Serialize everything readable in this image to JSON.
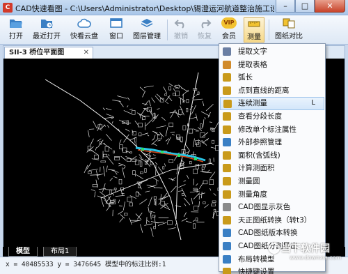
{
  "window": {
    "title": "CAD快速看图 - C:\\Users\\Administrator\\Desktop\\锡澄运河航道整治施工设计图纸\\锡澄运...",
    "app_icon_glyph": "C",
    "minimize": "–",
    "maximize": "□",
    "close": "✕"
  },
  "toolbar": {
    "open": "打开",
    "recent": "最近打开",
    "cloud": "快看云盘",
    "window": "窗口",
    "layers": "图层管理",
    "undo": "撤销",
    "redo": "恢复",
    "vip": "会员",
    "vip_badge": "VIP",
    "measure": "测量",
    "compare": "图纸对比"
  },
  "document": {
    "tab_title": "SII-3 桥位平面图",
    "tab_close": "✕"
  },
  "layouts": {
    "model": "模型",
    "layout1": "布局1"
  },
  "status": {
    "text": "x = 40485533  y = 3476645  模型中的标注比例:1"
  },
  "measure_menu": {
    "items": [
      {
        "label": "提取文字",
        "icon": "extract-text-icon",
        "color": "#6b7fa3"
      },
      {
        "label": "提取表格",
        "icon": "extract-table-icon",
        "color": "#d18a2a"
      },
      {
        "label": "弧长",
        "icon": "arc-length-icon",
        "color": "#c99a1a"
      },
      {
        "label": "点到直线的距离",
        "icon": "point-line-distance-icon",
        "color": "#c99a1a"
      },
      {
        "label": "连续测量",
        "icon": "continuous-measure-icon",
        "color": "#c99a1a",
        "shortcut": "L",
        "highlighted": true
      },
      {
        "label": "查看分段长度",
        "icon": "segment-length-icon",
        "color": "#c99a1a"
      },
      {
        "label": "修改单个标注属性",
        "icon": "edit-dimension-icon",
        "color": "#c99a1a"
      },
      {
        "label": "外部参照管理",
        "icon": "xref-manager-icon",
        "color": "#3a7fc4"
      },
      {
        "label": "面积(含弧线)",
        "icon": "area-arc-icon",
        "color": "#c99a1a"
      },
      {
        "label": "计算测面积",
        "icon": "calc-area-icon",
        "color": "#c99a1a"
      },
      {
        "label": "测量圆",
        "icon": "measure-circle-icon",
        "color": "#c99a1a"
      },
      {
        "label": "测量角度",
        "icon": "measure-angle-icon",
        "color": "#c99a1a"
      },
      {
        "label": "CAD图显示灰色",
        "icon": "gray-display-icon",
        "color": "#8a8a8a"
      },
      {
        "label": "天正图纸转换（转t3）",
        "icon": "tangent-convert-icon",
        "color": "#c99a1a"
      },
      {
        "label": "CAD图纸版本转换",
        "icon": "version-convert-icon",
        "color": "#3a7fc4"
      },
      {
        "label": "CAD图纸分割导出",
        "icon": "split-export-icon",
        "color": "#3a7fc4"
      },
      {
        "label": "布局转模型",
        "icon": "layout-to-model-icon",
        "color": "#3a7fc4"
      },
      {
        "label": "快捷键设置",
        "icon": "shortcut-settings-icon",
        "color": "#c99a1a"
      }
    ]
  },
  "watermark": {
    "text": "当下软件园",
    "url": "www.downxia.com"
  }
}
